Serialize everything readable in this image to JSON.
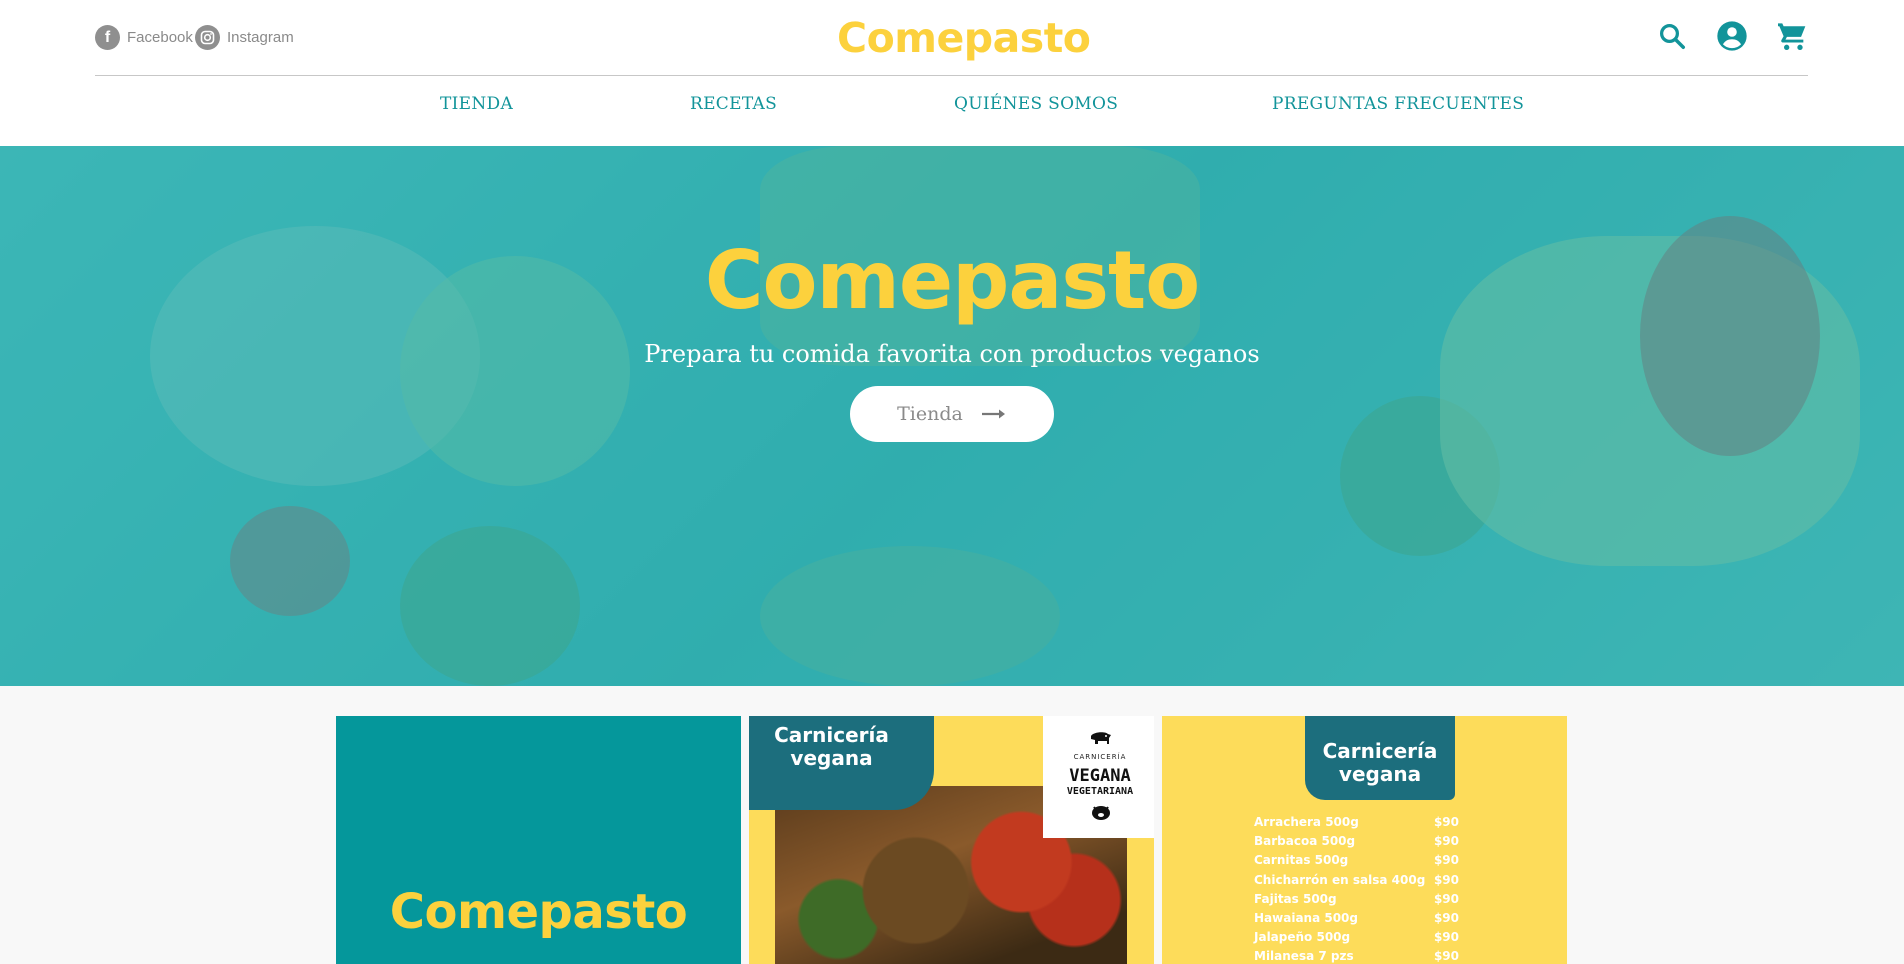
{
  "header": {
    "social": [
      {
        "label": "Facebook",
        "icon": "facebook-icon"
      },
      {
        "label": "Instagram",
        "icon": "instagram-icon"
      }
    ],
    "logo": "Comepasto",
    "icons": [
      "search-icon",
      "account-icon",
      "cart-icon"
    ]
  },
  "nav": {
    "items": [
      "TIENDA",
      "RECETAS",
      "QUIÉNES SOMOS",
      "PREGUNTAS FRECUENTES"
    ]
  },
  "hero": {
    "title": "Comepasto",
    "subtitle": "Prepara tu comida favorita con productos veganos",
    "button_label": "Tienda"
  },
  "cards": {
    "card1_brand": "Comepasto",
    "card2": {
      "banner_line1": "Carnicería",
      "banner_line2": "vegana",
      "badge_small": "CARNICERÍA",
      "badge_main": "VEGANA",
      "badge_sub": "VEGETARIANA"
    },
    "card3": {
      "banner_line1": "Carnicería",
      "banner_line2": "vegana",
      "menu": [
        {
          "item": "Arrachera 500g",
          "price": "$90"
        },
        {
          "item": "Barbacoa 500g",
          "price": "$90"
        },
        {
          "item": "Carnitas 500g",
          "price": "$90"
        },
        {
          "item": "Chicharrón en salsa 400g",
          "price": "$90"
        },
        {
          "item": "Fajitas 500g",
          "price": "$90"
        },
        {
          "item": "Hawaiana 500g",
          "price": "$90"
        },
        {
          "item": "Jalapeño 500g",
          "price": "$90"
        },
        {
          "item": "Milanesa 7 pzs",
          "price": "$90"
        }
      ]
    }
  },
  "colors": {
    "brand_yellow": "#fcd13d",
    "brand_teal": "#12949a",
    "dark_teal": "#1c6e7d"
  }
}
